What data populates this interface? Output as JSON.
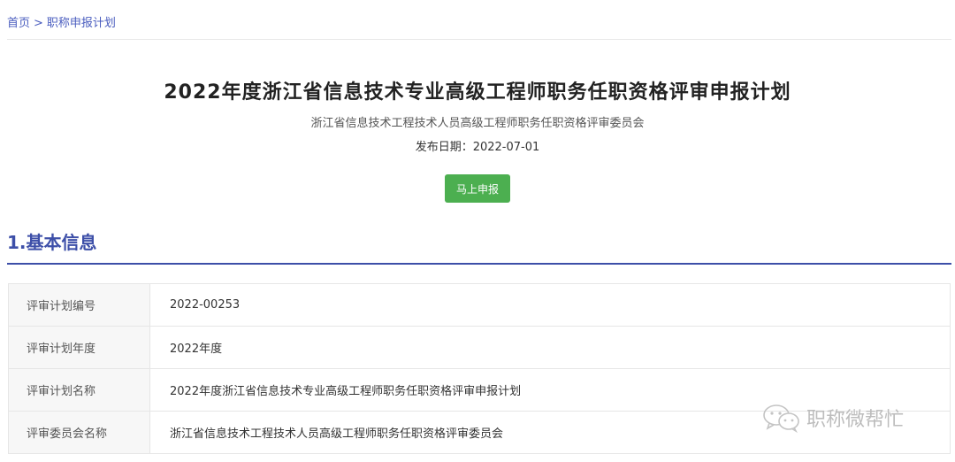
{
  "breadcrumb": {
    "home": "首页",
    "separator": ">",
    "current": "职称申报计划"
  },
  "header": {
    "title": "2022年度浙江省信息技术专业高级工程师职务任职资格评审申报计划",
    "committee": "浙江省信息技术工程技术人员高级工程师职务任职资格评审委员会",
    "publish_date": "发布日期：2022-07-01",
    "apply_button": "马上申报"
  },
  "section": {
    "title": "1.基本信息"
  },
  "info_rows": [
    {
      "label": "评审计划编号",
      "value": "2022-00253"
    },
    {
      "label": "评审计划年度",
      "value": "2022年度"
    },
    {
      "label": "评审计划名称",
      "value": "2022年度浙江省信息技术专业高级工程师职务任职资格评审申报计划"
    },
    {
      "label": "评审委员会名称",
      "value": "浙江省信息技术工程技术人员高级工程师职务任职资格评审委员会"
    }
  ],
  "watermark": {
    "text": "职称微帮忙",
    "icon": "wechat-icon"
  },
  "colors": {
    "link": "#4a5dbf",
    "section_accent": "#3d4fa8",
    "button": "#4caf50"
  }
}
